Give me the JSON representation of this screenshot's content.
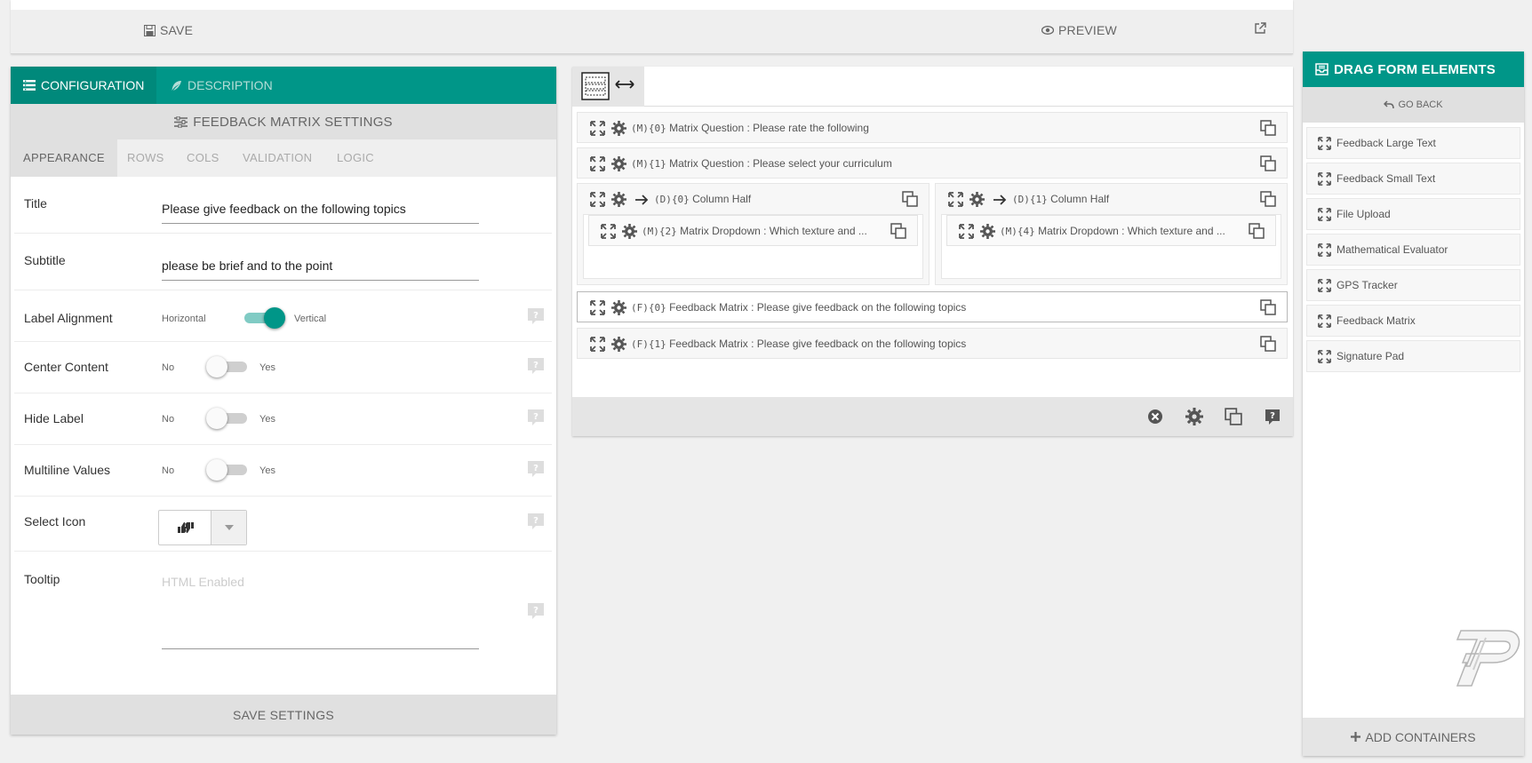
{
  "toolbar": {
    "save": "SAVE",
    "preview": "PREVIEW"
  },
  "left_panel": {
    "tabs": [
      "CONFIGURATION",
      "DESCRIPTION"
    ],
    "settings_title": "FEEDBACK MATRIX SETTINGS",
    "sub_tabs": [
      "APPEARANCE",
      "ROWS",
      "COLS",
      "VALIDATION",
      "LOGIC"
    ],
    "fields": {
      "title": {
        "label": "Title",
        "value": "Please give feedback on the following topics"
      },
      "subtitle": {
        "label": "Subtitle",
        "value": "please be brief and to the point"
      },
      "label_alignment": {
        "label": "Label Alignment",
        "left": "Horizontal",
        "right": "Vertical",
        "on": true
      },
      "center_content": {
        "label": "Center Content",
        "left": "No",
        "right": "Yes",
        "on": false
      },
      "hide_label": {
        "label": "Hide Label",
        "left": "No",
        "right": "Yes",
        "on": false
      },
      "multiline_values": {
        "label": "Multiline Values",
        "left": "No",
        "right": "Yes",
        "on": false
      },
      "select_icon": {
        "label": "Select Icon",
        "value_icon": "thumbs-icon"
      },
      "tooltip": {
        "label": "Tooltip",
        "placeholder": "HTML Enabled"
      }
    },
    "save_settings": "SAVE SETTINGS"
  },
  "middle_panel": {
    "rows": [
      {
        "tag": "(M){0}",
        "text": "Matrix Question : Please rate the following"
      },
      {
        "tag": "(M){1}",
        "text": "Matrix Question : Please select your curriculum"
      }
    ],
    "columns": [
      {
        "tag": "(D){0}",
        "text": "Column Half",
        "child_tag": "(M){2}",
        "child_text": "Matrix Dropdown : Which texture and ..."
      },
      {
        "tag": "(D){1}",
        "text": "Column Half",
        "child_tag": "(M){4}",
        "child_text": "Matrix Dropdown : Which texture and ..."
      }
    ],
    "feedback_rows": [
      {
        "tag": "(F){0}",
        "text": "Feedback Matrix : Please give feedback on the following topics",
        "selected": true
      },
      {
        "tag": "(F){1}",
        "text": "Feedback Matrix : Please give feedback on the following topics",
        "selected": false
      }
    ]
  },
  "right_panel": {
    "title": "DRAG FORM ELEMENTS",
    "go_back": "GO BACK",
    "items": [
      "Feedback Large Text",
      "Feedback Small Text",
      "File Upload",
      "Mathematical Evaluator",
      "GPS Tracker",
      "Feedback Matrix",
      "Signature Pad"
    ],
    "add_containers": "ADD CONTAINERS"
  },
  "colors": {
    "accent": "#009688",
    "accent_dark": "#00897b",
    "panel_gray": "#e0e0e0"
  }
}
